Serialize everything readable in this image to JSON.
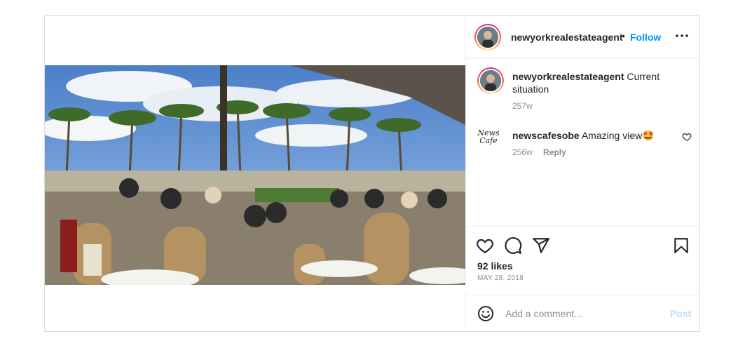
{
  "post": {
    "author": "newyorkrealestateagent",
    "separator": "•",
    "follow_label": "Follow",
    "caption": {
      "username": "newyorkrealestateagent",
      "text": "Current situation",
      "time": "257w"
    },
    "comments": [
      {
        "username": "newscafesobe",
        "text": "Amazing view🤩",
        "time": "256w",
        "reply_label": "Reply",
        "avatar_text_1": "News",
        "avatar_text_2": "Cafe"
      }
    ],
    "likes": "92 likes",
    "date": "MAY 28, 2018",
    "comment_placeholder": "Add a comment...",
    "post_label": "Post"
  },
  "icons": {
    "more": "more-options-icon",
    "like": "heart-icon",
    "comment": "comment-icon",
    "share": "share-icon",
    "save": "bookmark-icon",
    "emoji": "emoji-icon"
  },
  "colors": {
    "follow": "#0095f6",
    "post_disabled": "#b2dffc",
    "border": "#dbdbdb"
  }
}
